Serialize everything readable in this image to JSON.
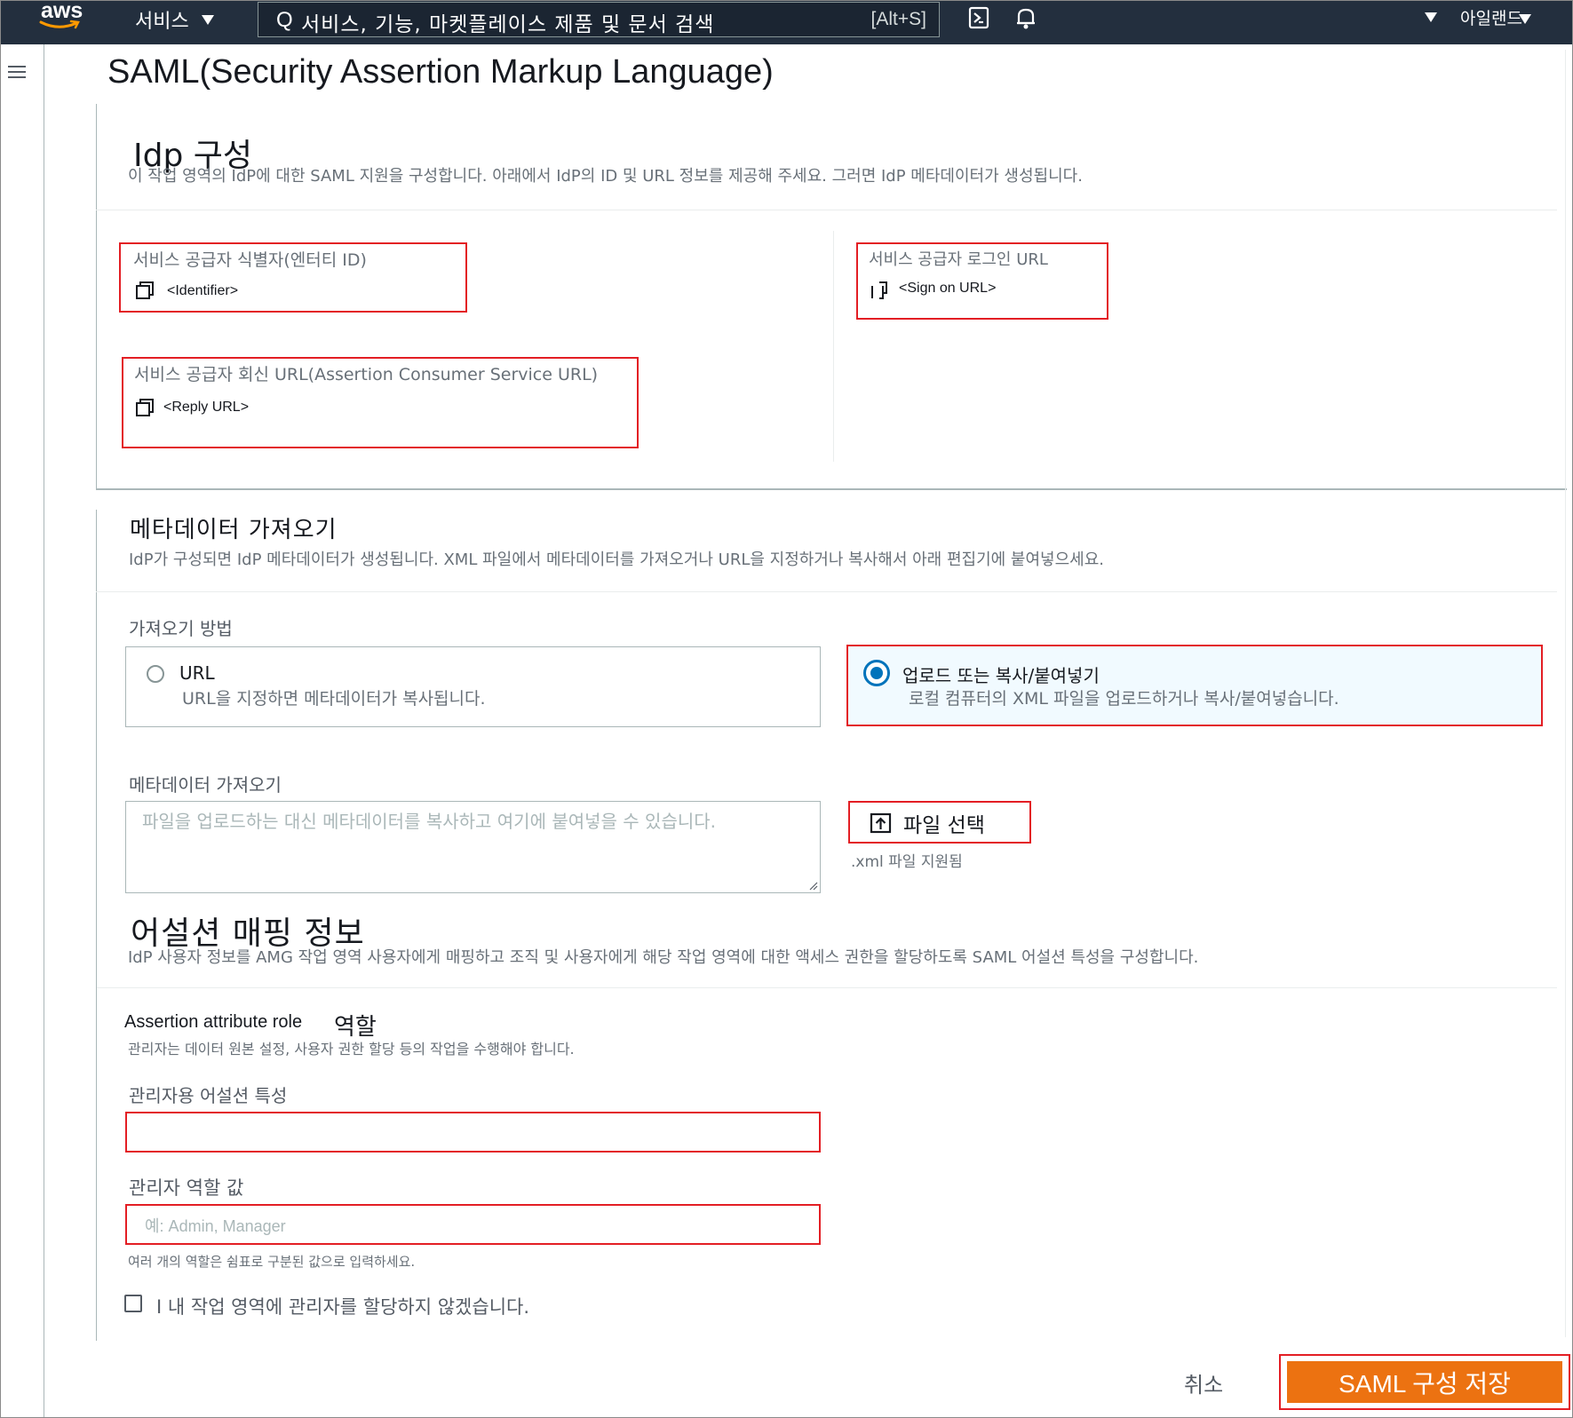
{
  "topbar": {
    "logo_text": "aws",
    "services_label": "서비스",
    "search_placeholder": "서비스, 기능, 마켓플레이스 제품 및 문서 검색",
    "search_shortcut": "[Alt+S]",
    "account_label": "아일랜드"
  },
  "page": {
    "title": "SAML(Security Assertion Markup Language)"
  },
  "idp_section": {
    "title": "Idp 구성",
    "description": "이 작업 영역의 IdP에 대한 SAML 지원을 구성합니다. 아래에서 IdP의 ID 및 URL 정보를 제공해 주세요. 그러면 IdP 메타데이터가 생성됩니다.",
    "entity_id_label": "서비스 공급자 식별자(엔터티 ID)",
    "entity_id_value": "<Identifier>",
    "reply_url_label": "서비스 공급자 회신 URL(Assertion Consumer Service URL)",
    "reply_url_value": "<Reply URL>",
    "sign_on_label": "서비스 공급자 로그인 URL",
    "sign_on_value": "<Sign on URL>"
  },
  "metadata_section": {
    "title": "메타데이터 가져오기",
    "description": "IdP가 구성되면 IdP 메타데이터가 생성됩니다. XML 파일에서 메타데이터를 가져오거나 URL을 지정하거나 복사해서 아래 편집기에 붙여넣으세요.",
    "method_label": "가져오기 방법",
    "option_url_title": "URL",
    "option_url_desc": "URL을 지정하면 메타데이터가 복사됩니다.",
    "option_upload_title": "업로드 또는 복사/붙여넣기",
    "option_upload_desc": "로컬 컴퓨터의 XML 파일을 업로드하거나 복사/붙여넣습니다.",
    "selected_option": "upload",
    "import_label": "메타데이터 가져오기",
    "textarea_placeholder": "파일을 업로드하는 대신 메타데이터를 복사하고 여기에 붙여넣을 수 있습니다.",
    "file_button_label": "파일 선택",
    "file_hint": ".xml 파일 지원됨"
  },
  "assertion_section": {
    "title": "어설션 매핑 정보",
    "description": "IdP 사용자 정보를 AMG 작업 영역 사용자에게 매핑하고 조직 및 사용자에게 해당 작업 영역에 대한 액세스 권한을 할당하도록 SAML 어설션 특성을 구성합니다.",
    "role_heading_en": "Assertion attribute role",
    "role_heading_ko": "역할",
    "role_desc": "관리자는 데이터 원본 설정, 사용자 권한 할당 등의 작업을 수행해야 합니다.",
    "admin_attr_label": "관리자용 어설션 특성",
    "admin_attr_value": "",
    "admin_role_label": "관리자 역할 값",
    "admin_role_placeholder": "예: Admin, Manager",
    "admin_role_hint": "여러 개의 역할은 쉼표로 구분된 값으로 입력하세요.",
    "no_admin_checkbox_label": "내 작업 영역에 관리자를 할당하지 않겠습니다.",
    "no_admin_checked": false
  },
  "footer": {
    "cancel_label": "취소",
    "save_label": "SAML 구성 저장"
  },
  "colors": {
    "nav_bg": "#232f3e",
    "primary_button": "#ec7211",
    "highlight_border": "#e31e24",
    "radio_selected": "#0073bb"
  }
}
